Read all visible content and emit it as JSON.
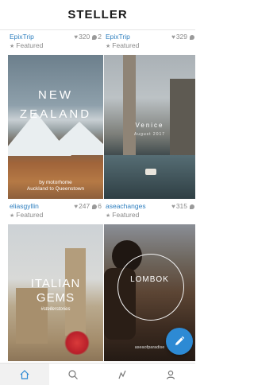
{
  "app": {
    "title": "STELLER"
  },
  "stories": [
    {
      "user": "EpixTrip",
      "likes": "320",
      "comments": "2",
      "badge": "Featured",
      "title_line1": "NEW",
      "title_line2": "ZEALAND",
      "subtitle_line1": "by motorhome",
      "subtitle_line2": "Auckland to Queenstown"
    },
    {
      "user": "EpixTrip",
      "likes": "329",
      "comments": "",
      "badge": "Featured",
      "title_line1": "Venice",
      "subtitle_line1": "August 2017"
    },
    {
      "user": "eliasgyllin",
      "likes": "247",
      "comments": "6",
      "badge": "Featured",
      "title_line1": "ITALIAN",
      "title_line2": "GEMS",
      "subtitle_line1": "#stellerstories"
    },
    {
      "user": "aseachanges",
      "likes": "315",
      "comments": "",
      "badge": "Featured",
      "title_line1": "LOMBOK",
      "subtitle_line1": "aseaofparadise"
    }
  ],
  "fab": {
    "icon": "pencil-icon"
  },
  "tabs": [
    {
      "name": "home",
      "icon": "home-icon",
      "active": true
    },
    {
      "name": "search",
      "icon": "search-icon",
      "active": false
    },
    {
      "name": "activity",
      "icon": "activity-icon",
      "active": false
    },
    {
      "name": "profile",
      "icon": "profile-icon",
      "active": false
    }
  ],
  "colors": {
    "accent": "#2d8ad4",
    "link": "#2f7fbf",
    "muted": "#8a8a8a"
  }
}
